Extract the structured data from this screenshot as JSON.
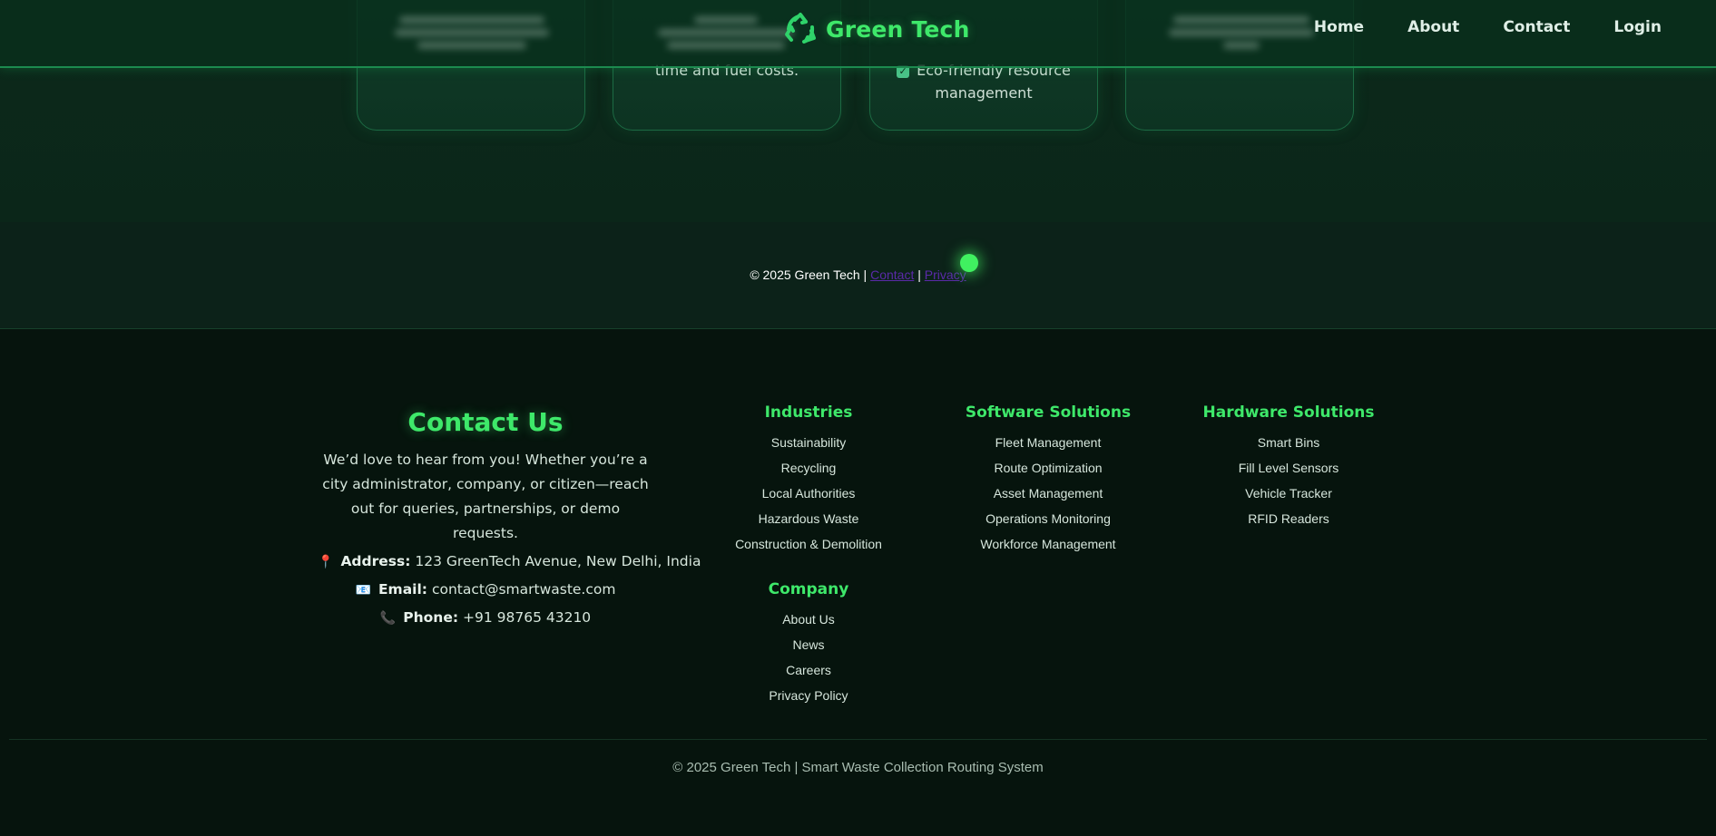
{
  "features": {
    "card2_tail": "time and fuel costs.",
    "card3_tail": "Eco-friendly resource management"
  },
  "header": {
    "brand": "Green Tech",
    "nav": [
      "Home",
      "About",
      "Contact",
      "Login"
    ]
  },
  "band": {
    "prefix": "© 2025 Green Tech |",
    "contact_link": "Contact",
    "separator": "|",
    "privacy_link": "Privacy"
  },
  "contact": {
    "title": "Contact Us",
    "intro": "We’d love to hear from you! Whether you’re a city administrator, company, or citizen—reach out for queries, partnerships, or demo requests.",
    "address_label": "Address:",
    "address": "123 GreenTech Avenue, New Delhi, India",
    "email_label": "Email:",
    "email": "contact@smartwaste.com",
    "phone_label": "Phone:",
    "phone": "+91 98765 43210"
  },
  "industries": {
    "title": "Industries",
    "items": [
      "Sustainability",
      "Recycling",
      "Local Authorities",
      "Hazardous Waste",
      "Construction & Demolition"
    ]
  },
  "company": {
    "title": "Company",
    "items": [
      "About Us",
      "News",
      "Careers",
      "Privacy Policy"
    ]
  },
  "software": {
    "title": "Software Solutions",
    "items": [
      "Fleet Management",
      "Route Optimization",
      "Asset Management",
      "Operations Monitoring",
      "Workforce Management"
    ]
  },
  "hardware": {
    "title": "Hardware Solutions",
    "items": [
      "Smart Bins",
      "Fill Level Sensors",
      "Vehicle Tracker",
      "RFID Readers"
    ]
  },
  "footer": {
    "copyright": "© 2025 Green Tech | Smart Waste Collection Routing System"
  }
}
